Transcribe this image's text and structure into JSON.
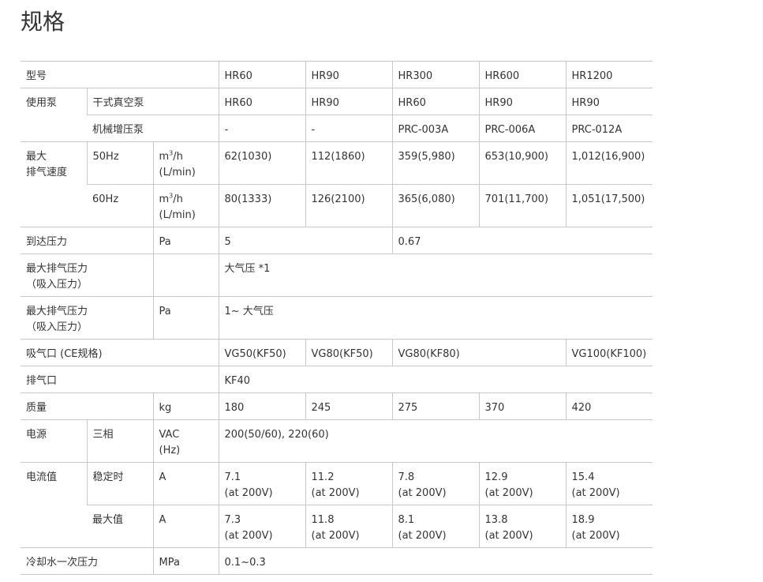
{
  "title": "规格",
  "models": [
    "HR60",
    "HR90",
    "HR300",
    "HR600",
    "HR1200"
  ],
  "rows": {
    "model": {
      "label": "型号"
    },
    "pump": {
      "label": "使用泵",
      "dry_label": "干式真空泵",
      "dry_values": [
        "HR60",
        "HR90",
        "HR60",
        "HR90",
        "HR90"
      ],
      "booster_label": "机械增压泵",
      "booster_values": [
        "-",
        "-",
        "PRC-003A",
        "PRC-006A",
        "PRC-012A"
      ]
    },
    "speed": {
      "label_line1": "最大",
      "label_line2": "排气速度",
      "unit_m": "m",
      "unit_sup": "3",
      "unit_h": "/h",
      "unit_line2": "(L/min)",
      "hz50_label": "50Hz",
      "hz50_values": [
        "62(1030)",
        "112(1860)",
        "359(5,980)",
        "653(10,900)",
        "1,012(16,900)"
      ],
      "hz60_label": "60Hz",
      "hz60_values": [
        "80(1333)",
        "126(2100)",
        "365(6,080)",
        "701(11,700)",
        "1,051(17,500)"
      ]
    },
    "ultimate": {
      "label": "到达压力",
      "unit": "Pa",
      "value_a": "5",
      "value_b": "0.67"
    },
    "max_exhaust_1": {
      "label_line1": "最大排气压力",
      "label_line2": "（吸入压力）",
      "unit": "",
      "value": "大气压 *1"
    },
    "max_exhaust_2": {
      "label_line1": "最大排气压力",
      "label_line2": "（吸入压力）",
      "unit": "Pa",
      "value": "1~ 大气压"
    },
    "inlet": {
      "label": "吸气口 (CE规格)",
      "values": [
        "VG50(KF50)",
        "VG80(KF50)",
        "VG80(KF80)",
        "VG100(KF100)"
      ]
    },
    "outlet": {
      "label": "排气口",
      "value": "KF40"
    },
    "mass": {
      "label": "质量",
      "unit": "kg",
      "values": [
        "180",
        "245",
        "275",
        "370",
        "420"
      ]
    },
    "power": {
      "label": "电源",
      "sub_label": "三相",
      "unit_line1": "VAC",
      "unit_line2": "(Hz)",
      "value": "200(50/60), 220(60)"
    },
    "current": {
      "label": "电流值",
      "unit": "A",
      "at": "(at 200V)",
      "steady_label": "稳定时",
      "steady_values": [
        "7.1",
        "11.2",
        "7.8",
        "12.9",
        "15.4"
      ],
      "max_label": "最大值",
      "max_values": [
        "7.3",
        "11.8",
        "8.1",
        "13.8",
        "18.9"
      ]
    },
    "cooling": {
      "label": "冷却水一次压力",
      "unit": "MPa",
      "value": "0.1~0.3"
    }
  }
}
